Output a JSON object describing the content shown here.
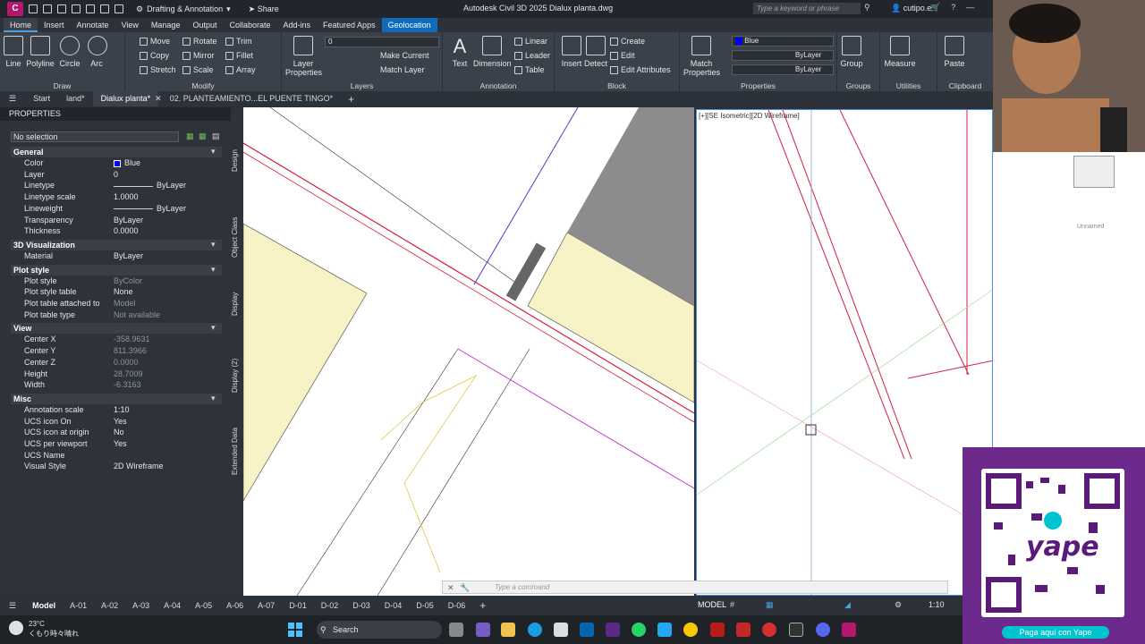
{
  "titlebar": {
    "app_letter": "C",
    "workspace": "Drafting & Annotation",
    "share": "Share",
    "title": "Autodesk Civil 3D 2025   Dialux planta.dwg",
    "search_placeholder": "Type a keyword or phrase",
    "user": "cutipo.e"
  },
  "ribbon_tabs": [
    "Home",
    "Insert",
    "Annotate",
    "View",
    "Manage",
    "Output",
    "Collaborate",
    "Add-ins",
    "Featured Apps",
    "Geolocation"
  ],
  "ribbon": {
    "draw": {
      "title": "Draw",
      "line": "Line",
      "polyline": "Polyline",
      "circle": "Circle",
      "arc": "Arc"
    },
    "modify": {
      "title": "Modify",
      "move": "Move",
      "rotate": "Rotate",
      "trim": "Trim",
      "copy": "Copy",
      "mirror": "Mirror",
      "fillet": "Fillet",
      "stretch": "Stretch",
      "scale": "Scale",
      "array": "Array"
    },
    "layers": {
      "title": "Layers",
      "layer_properties": "Layer Properties",
      "current_layer": "0",
      "make_current": "Make Current",
      "match_layer": "Match Layer"
    },
    "annotation": {
      "title": "Annotation",
      "text": "Text",
      "dimension": "Dimension",
      "linear": "Linear",
      "leader": "Leader",
      "table": "Table"
    },
    "block": {
      "title": "Block",
      "insert": "Insert",
      "detect": "Detect",
      "create": "Create",
      "edit": "Edit",
      "edit_attributes": "Edit Attributes"
    },
    "properties": {
      "title": "Properties",
      "match_properties": "Match Properties",
      "color": "Blue",
      "linetype": "ByLayer",
      "lineweight": "ByLayer"
    },
    "groups": {
      "title": "Groups",
      "group": "Group"
    },
    "utilities": {
      "title": "Utilities",
      "measure": "Measure"
    },
    "clipboard": {
      "title": "Clipboard",
      "paste": "Paste"
    }
  },
  "doc_tabs": [
    "Start",
    "land*",
    "Dialux planta*",
    "02. PLANTEAMIENTO...EL PUENTE TINGO*"
  ],
  "properties_palette": {
    "title": "PROPERTIES",
    "selection": "No selection",
    "sections": [
      {
        "name": "General",
        "rows": [
          {
            "k": "Color",
            "v": "Blue"
          },
          {
            "k": "Layer",
            "v": "0"
          },
          {
            "k": "Linetype",
            "v": "ByLayer"
          },
          {
            "k": "Linetype scale",
            "v": "1.0000"
          },
          {
            "k": "Lineweight",
            "v": "ByLayer"
          },
          {
            "k": "Transparency",
            "v": "ByLayer"
          },
          {
            "k": "Thickness",
            "v": "0.0000"
          }
        ]
      },
      {
        "name": "3D Visualization",
        "rows": [
          {
            "k": "Material",
            "v": "ByLayer"
          }
        ]
      },
      {
        "name": "Plot style",
        "rows": [
          {
            "k": "Plot style",
            "v": "ByColor"
          },
          {
            "k": "Plot style table",
            "v": "None"
          },
          {
            "k": "Plot table attached to",
            "v": "Model"
          },
          {
            "k": "Plot table type",
            "v": "Not available"
          }
        ]
      },
      {
        "name": "View",
        "rows": [
          {
            "k": "Center X",
            "v": "-358.9631"
          },
          {
            "k": "Center Y",
            "v": "811.3966"
          },
          {
            "k": "Center Z",
            "v": "0.0000"
          },
          {
            "k": "Height",
            "v": "28.7009"
          },
          {
            "k": "Width",
            "v": "-6.3163"
          }
        ]
      },
      {
        "name": "Misc",
        "rows": [
          {
            "k": "Annotation scale",
            "v": "1:10"
          },
          {
            "k": "UCS icon On",
            "v": "Yes"
          },
          {
            "k": "UCS icon at origin",
            "v": "No"
          },
          {
            "k": "UCS per viewport",
            "v": "Yes"
          },
          {
            "k": "UCS Name",
            "v": ""
          },
          {
            "k": "Visual Style",
            "v": "2D Wireframe"
          }
        ]
      }
    ],
    "side_tabs": [
      "Design",
      "Object Class",
      "Display",
      "Display (2)",
      "Extended Data"
    ]
  },
  "viewport_right": {
    "label": "[+][SE Isometric][2D Wireframe]",
    "viewcube_label": "Unnamed"
  },
  "command_line": {
    "placeholder": "Type a command"
  },
  "layout_tabs": [
    "Model",
    "A-01",
    "A-02",
    "A-03",
    "A-04",
    "A-05",
    "A-06",
    "A-07",
    "D-01",
    "D-02",
    "D-03",
    "D-04",
    "D-05",
    "D-06"
  ],
  "status": {
    "model": "MODEL",
    "scale": "1:10"
  },
  "taskbar": {
    "temperature": "23°C",
    "weather": "くもり時々晴れ",
    "search": "Search"
  },
  "overlay": {
    "payment_label": "Paga aquí con Yape",
    "qr_brand": "yape"
  }
}
